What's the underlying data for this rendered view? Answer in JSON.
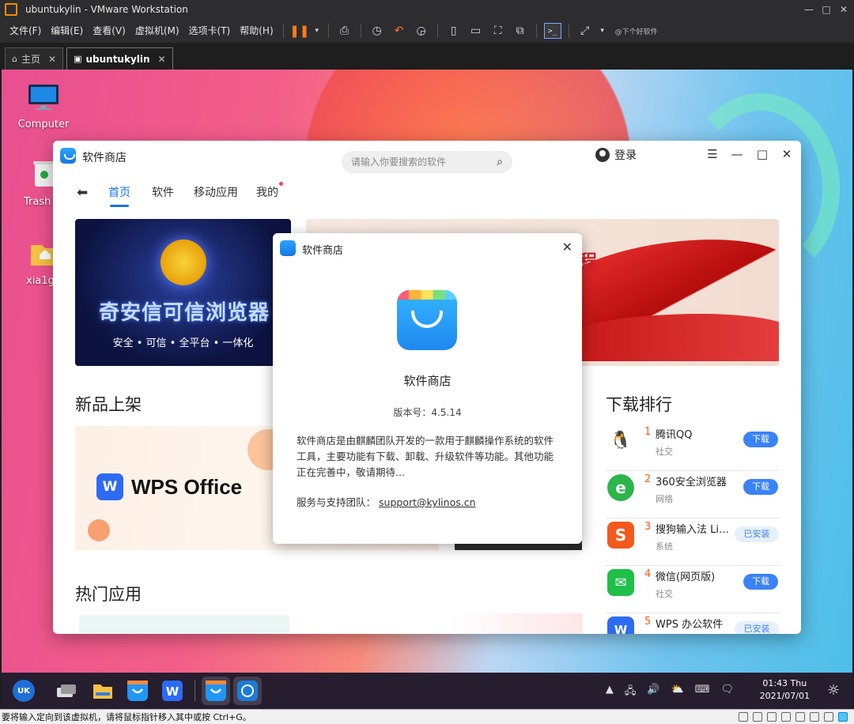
{
  "vmware": {
    "title": "ubuntukylin - VMware Workstation",
    "window_controls": [
      "—",
      "□",
      "✕"
    ],
    "menu": [
      "文件(F)",
      "编辑(E)",
      "查看(V)",
      "虚拟机(M)",
      "选项卡(T)",
      "帮助(H)"
    ],
    "toolbar_note": "@下个好软件",
    "tabs": [
      {
        "label": "主页",
        "close": "✕",
        "active": false
      },
      {
        "label": "ubuntukylin",
        "close": "✕",
        "active": true
      }
    ],
    "status_text": "要将输入定向到该虚拟机，请将鼠标指针移入其中或按 Ctrl+G。"
  },
  "desktop": {
    "icons": [
      {
        "label": "Computer",
        "icon": "monitor-icon"
      },
      {
        "label": "Trash",
        "icon": "trash-icon"
      },
      {
        "label": "xia1g",
        "icon": "home-folder-icon"
      }
    ]
  },
  "taskbar": {
    "clock_time": "01:43 Thu",
    "clock_date": "2021/07/01",
    "apps": [
      "start-menu",
      "multitask-view",
      "file-manager",
      "software-store",
      "wps-writer",
      "software-store-active",
      "screenshot-tool"
    ]
  },
  "store": {
    "title": "软件商店",
    "search_placeholder": "请输入你要搜索的软件",
    "login": "登录",
    "controls": [
      "☰",
      "—",
      "□",
      "✕"
    ],
    "back": "⬅",
    "nav": [
      "首页",
      "软件",
      "移动应用",
      "我的"
    ],
    "banner1": {
      "headline": "奇安信可信浏览器",
      "subline": "安全 • 可信 • 全平台 • 一体化"
    },
    "banner2": {
      "fragment": "程"
    },
    "new_section": "新品上架",
    "wps_name": "WPS Office",
    "wps_icon_letter": "W",
    "hot_section": "热门应用",
    "rank_section": "下载排行",
    "rank": [
      {
        "num": "1",
        "name": "腾讯QQ",
        "category": "社交",
        "action": "下载",
        "state": "download",
        "icon_color": "#ffffff",
        "icon_text": "🐧"
      },
      {
        "num": "2",
        "name": "360安全浏览器",
        "category": "网络",
        "action": "下载",
        "state": "download",
        "icon_color": "#2bb54b",
        "icon_text": "e"
      },
      {
        "num": "3",
        "name": "搜狗输入法 Li…",
        "category": "系统",
        "action": "已安装",
        "state": "installed",
        "icon_color": "#f25a1d",
        "icon_text": "S"
      },
      {
        "num": "4",
        "name": "微信(网页版)",
        "category": "社交",
        "action": "下载",
        "state": "download",
        "icon_color": "#1fbf4a",
        "icon_text": "✉"
      },
      {
        "num": "5",
        "name": "WPS 办公软件",
        "category": "",
        "action": "已安装",
        "state": "installed",
        "icon_color": "#2d6bf5",
        "icon_text": "W"
      }
    ]
  },
  "about": {
    "title": "软件商店",
    "close": "✕",
    "app_name": "软件商店",
    "version": "版本号：4.5.14",
    "description": "软件商店是由麒麟团队开发的一款用于麒麟操作系统的软件工具，主要功能有下载、卸载、升级软件等功能。其他功能正在完善中，敬请期待...",
    "support_label": "服务与支持团队：",
    "support_email": "support@kylinos.cn"
  }
}
